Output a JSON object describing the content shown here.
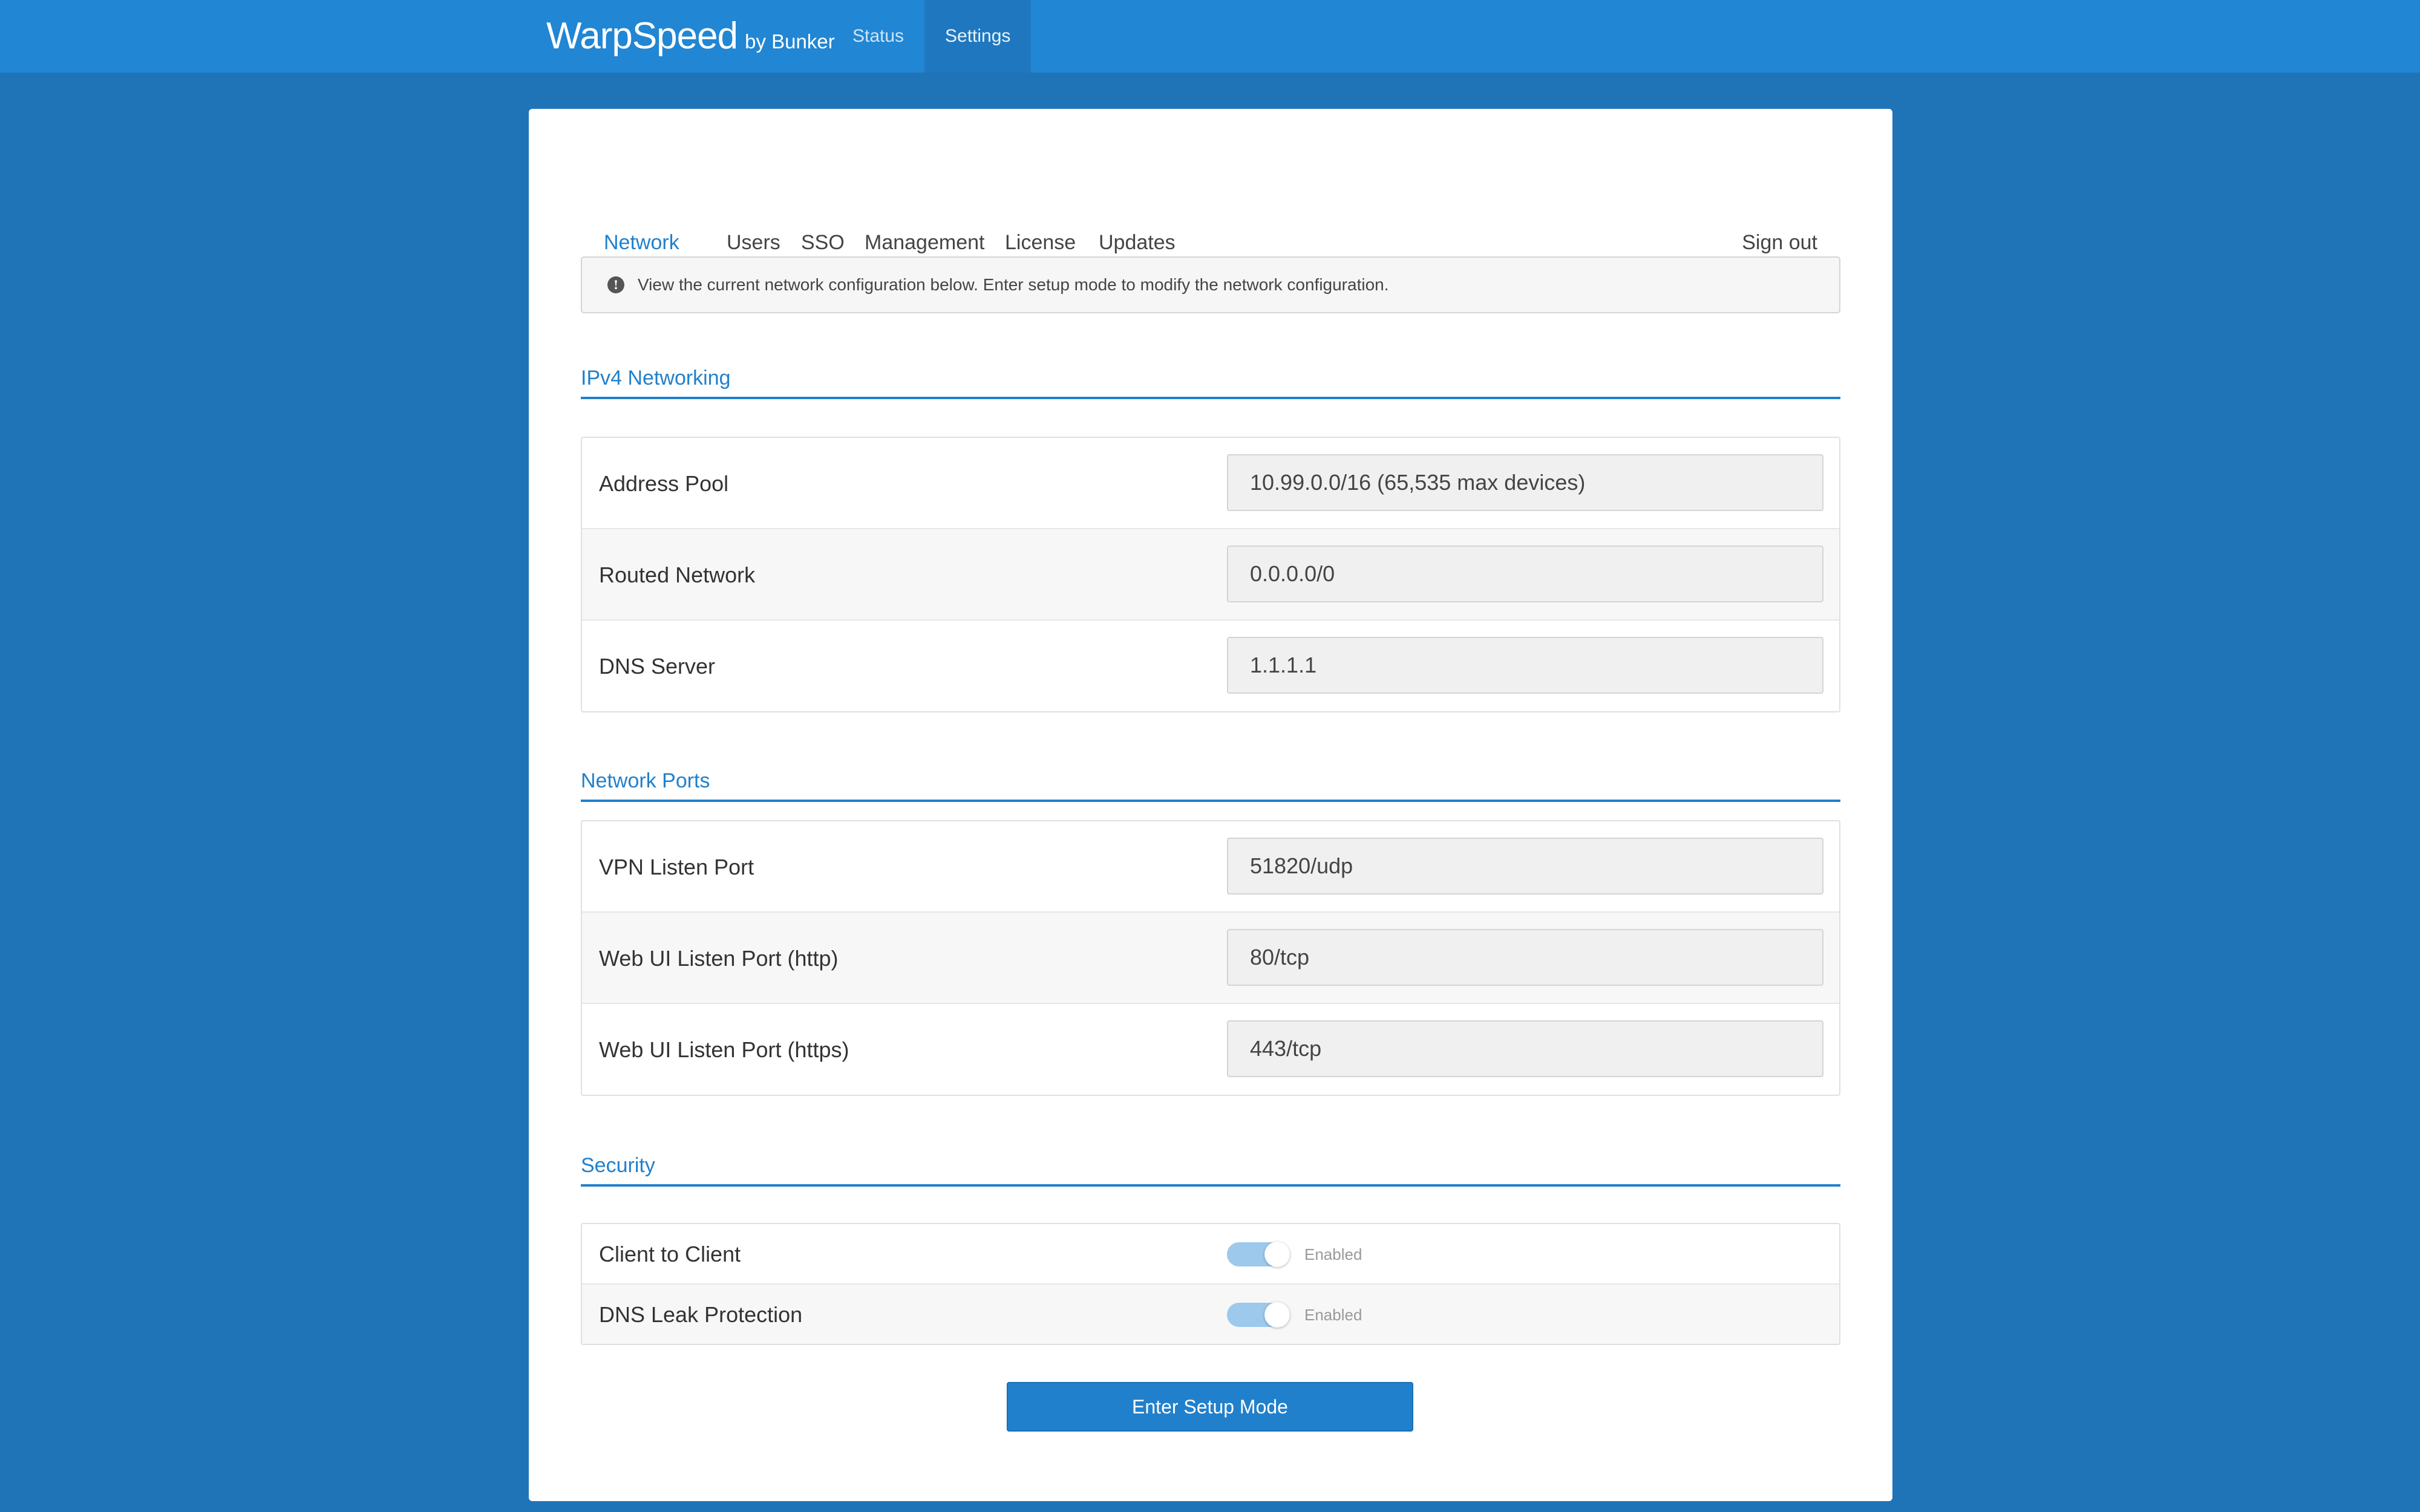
{
  "navbar": {
    "brand": "WarpSpeed",
    "brand_sub": "by Bunker",
    "links": [
      "Status",
      "Settings"
    ],
    "active": "Settings"
  },
  "tabs": {
    "items": [
      "Network",
      "Users",
      "SSO",
      "Management",
      "License",
      "Updates"
    ],
    "active": "Network",
    "sign_out": "Sign out"
  },
  "alert": {
    "icon": "info-icon",
    "text": "View the current network configuration below. Enter setup mode to modify the network configuration."
  },
  "ipv4": {
    "title": "IPv4 Networking",
    "rows": [
      {
        "label": "Address Pool",
        "value": "10.99.0.0/16 (65,535 max devices)"
      },
      {
        "label": "Routed Network",
        "value": "0.0.0.0/0"
      },
      {
        "label": "DNS Server",
        "value": "1.1.1.1"
      }
    ]
  },
  "ports": {
    "title": "Network Ports",
    "rows": [
      {
        "label": "VPN Listen Port",
        "value": "51820/udp"
      },
      {
        "label": "Web UI Listen Port (http)",
        "value": "80/tcp"
      },
      {
        "label": "Web UI Listen Port (https)",
        "value": "443/tcp"
      }
    ]
  },
  "security": {
    "title": "Security",
    "rows": [
      {
        "label": "Client to Client",
        "state": "Enabled"
      },
      {
        "label": "DNS Leak Protection",
        "state": "Enabled"
      }
    ]
  },
  "setup_button": "Enter Setup Mode",
  "colors": {
    "background": "#1f74b8",
    "navbar": "#2186d3",
    "accent": "#2180cc",
    "toggle_on": "#9cc9ec"
  }
}
